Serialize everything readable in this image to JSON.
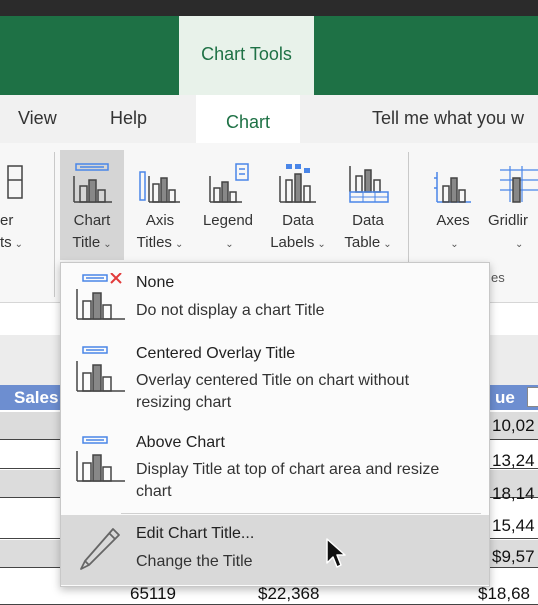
{
  "contextual_tab": {
    "label": "Chart Tools",
    "color": "#1e7145"
  },
  "tabs": [
    {
      "label": "View"
    },
    {
      "label": "Help"
    },
    {
      "label": "Chart",
      "active": true
    },
    {
      "label": "Tell me what you w"
    }
  ],
  "ribbon": {
    "partial_left": {
      "line1": "er",
      "line2": "ts"
    },
    "buttons": [
      {
        "line1": "Chart",
        "line2": "Title",
        "pressed": true
      },
      {
        "line1": "Axis",
        "line2": "Titles"
      },
      {
        "line1": "Legend",
        "line2": ""
      },
      {
        "line1": "Data",
        "line2": "Labels"
      },
      {
        "line1": "Data",
        "line2": "Table"
      },
      {
        "line1": "Axes",
        "line2": ""
      },
      {
        "line1": "Gridlir",
        "line2": ""
      }
    ],
    "group_label_fragment": "es"
  },
  "sheet": {
    "header_left": "Sales",
    "header_right": "ue",
    "right_values": [
      "10,02",
      "13,24",
      "18,14",
      "15,44",
      "$9,57"
    ],
    "bottom_row": [
      "65119",
      "$22,368",
      "$18,68"
    ]
  },
  "menu": {
    "items": [
      {
        "title": "None",
        "desc": "Do not display a chart Title",
        "icon": "chart-title-none-icon"
      },
      {
        "title": "Centered Overlay Title",
        "desc": "Overlay centered Title on chart without resizing chart",
        "icon": "chart-title-overlay-icon"
      },
      {
        "title": "Above Chart",
        "desc": "Display Title at top of chart area and resize chart",
        "icon": "chart-title-above-icon"
      },
      {
        "title": "Edit Chart Title...",
        "desc": "Change the Title",
        "icon": "pencil-icon",
        "hovered": true
      }
    ]
  },
  "colors": {
    "green": "#1e7145",
    "accent_blue": "#4a86e8",
    "sheet_header_blue": "#6d8ed0",
    "red_x": "#e23b3b"
  }
}
